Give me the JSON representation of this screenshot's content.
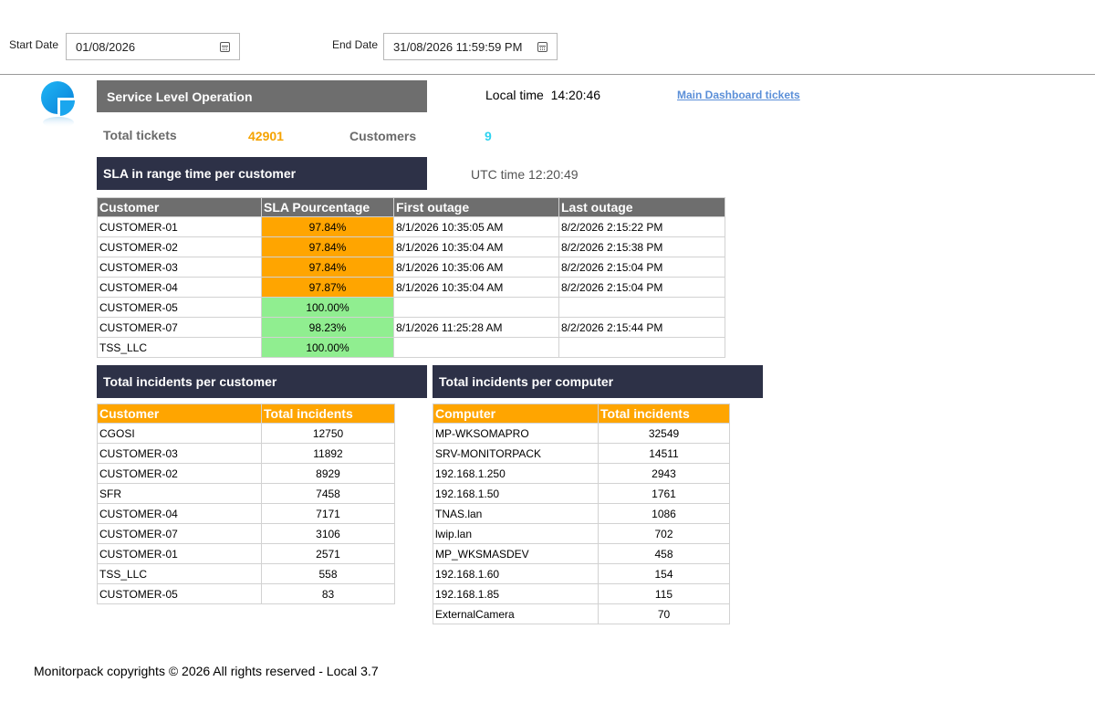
{
  "filters": {
    "start_label": "Start Date",
    "start_value": "01/08/2026",
    "end_label": "End Date",
    "end_value": "31/08/2026 11:59:59 PM"
  },
  "header": {
    "title": "Service Level Operation",
    "local_time_label": "Local time",
    "local_time_value": "14:20:46",
    "utc_time_label": "UTC time",
    "utc_time_value": "12:20:49",
    "dashboard_link": "Main Dashboard tickets"
  },
  "kpis": {
    "total_tickets_label": "Total tickets",
    "total_tickets_value": "42901",
    "customers_label": "Customers",
    "customers_value": "9"
  },
  "sla": {
    "title": "SLA in range time per customer",
    "columns": [
      "Customer",
      "SLA Pourcentage",
      "First outage",
      "Last outage"
    ],
    "rows": [
      {
        "customer": "CUSTOMER-01",
        "sla": "97.84%",
        "status": "warning",
        "first": "8/1/2026 10:35:05 AM",
        "last": "8/2/2026 2:15:22 PM"
      },
      {
        "customer": "CUSTOMER-02",
        "sla": "97.84%",
        "status": "warning",
        "first": "8/1/2026 10:35:04 AM",
        "last": "8/2/2026 2:15:38 PM"
      },
      {
        "customer": "CUSTOMER-03",
        "sla": "97.84%",
        "status": "warning",
        "first": "8/1/2026 10:35:06 AM",
        "last": "8/2/2026 2:15:04 PM"
      },
      {
        "customer": "CUSTOMER-04",
        "sla": "97.87%",
        "status": "warning",
        "first": "8/1/2026 10:35:04 AM",
        "last": "8/2/2026 2:15:04 PM"
      },
      {
        "customer": "CUSTOMER-05",
        "sla": "100.00%",
        "status": "ok",
        "first": "",
        "last": ""
      },
      {
        "customer": "CUSTOMER-07",
        "sla": "98.23%",
        "status": "ok",
        "first": "8/1/2026 11:25:28 AM",
        "last": "8/2/2026 2:15:44 PM"
      },
      {
        "customer": "TSS_LLC",
        "sla": "100.00%",
        "status": "ok",
        "first": "",
        "last": ""
      }
    ]
  },
  "incidents_customer": {
    "title": "Total incidents per customer",
    "columns": [
      "Customer",
      "Total incidents"
    ],
    "rows": [
      {
        "name": "CGOSI",
        "count": "12750"
      },
      {
        "name": "CUSTOMER-03",
        "count": "11892"
      },
      {
        "name": "CUSTOMER-02",
        "count": "8929"
      },
      {
        "name": "SFR",
        "count": "7458"
      },
      {
        "name": "CUSTOMER-04",
        "count": "7171"
      },
      {
        "name": "CUSTOMER-07",
        "count": "3106"
      },
      {
        "name": "CUSTOMER-01",
        "count": "2571"
      },
      {
        "name": "TSS_LLC",
        "count": "558"
      },
      {
        "name": "CUSTOMER-05",
        "count": "83"
      }
    ]
  },
  "incidents_computer": {
    "title": "Total incidents per computer",
    "columns": [
      "Computer",
      "Total incidents"
    ],
    "rows": [
      {
        "name": "MP-WKSOMAPRO",
        "count": "32549"
      },
      {
        "name": "SRV-MONITORPACK",
        "count": "14511"
      },
      {
        "name": "192.168.1.250",
        "count": "2943"
      },
      {
        "name": "192.168.1.50",
        "count": "1761"
      },
      {
        "name": "TNAS.lan",
        "count": "1086"
      },
      {
        "name": "lwip.lan",
        "count": "702"
      },
      {
        "name": "MP_WKSMASDEV",
        "count": "458"
      },
      {
        "name": "192.168.1.60",
        "count": "154"
      },
      {
        "name": "192.168.1.85",
        "count": "115"
      },
      {
        "name": "ExternalCamera",
        "count": "70"
      }
    ]
  },
  "footer": {
    "text": "Monitorpack copyrights © 2026 All rights reserved - Local 3.7"
  },
  "colors": {
    "band_gray": "#6e6e6e",
    "band_navy": "#2d3147",
    "sla_warning": "#ffa500",
    "sla_ok": "#90ee90",
    "kpi_orange": "#f5a300",
    "kpi_cyan": "#2fd3f0",
    "link": "#5b8fd8"
  },
  "icons": {
    "logo": "monitorpack-logo"
  }
}
